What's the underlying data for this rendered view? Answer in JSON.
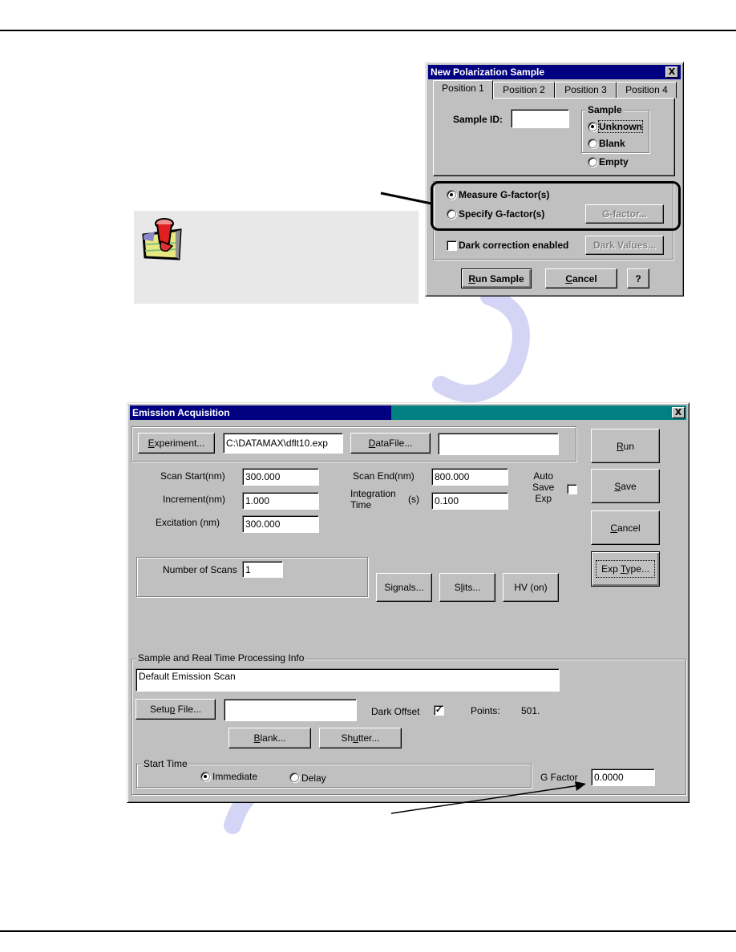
{
  "polarization_dialog": {
    "title": "New Polarization Sample",
    "close_label": "X",
    "tabs": [
      {
        "label": "Position 1",
        "active": true
      },
      {
        "label": "Position 2",
        "active": false
      },
      {
        "label": "Position 3",
        "active": false
      },
      {
        "label": "Position 4",
        "active": false
      }
    ],
    "sample_id_label": "Sample ID:",
    "sample_id_value": "",
    "sample_group_label": "Sample",
    "sample_options": [
      {
        "label": "Unknown",
        "selected": true
      },
      {
        "label": "Blank",
        "selected": false
      },
      {
        "label": "Empty",
        "selected": false
      }
    ],
    "gfactor_options": [
      {
        "label": "Measure G-factor(s)",
        "selected": true
      },
      {
        "label": "Specify G-factor(s)",
        "selected": false
      }
    ],
    "gfactor_button": "G-factor...",
    "dark_correction_label": "Dark correction enabled",
    "dark_correction_checked": false,
    "dark_values_button": "Dark Values...",
    "run_sample_button": {
      "mnemonic": "R",
      "rest": "un Sample"
    },
    "cancel_button": {
      "mnemonic": "C",
      "rest": "ancel"
    },
    "help_button": "?"
  },
  "note_box": {
    "icon": "pushpin-note-icon"
  },
  "emission_dialog": {
    "title": "Emission Acquisition",
    "close_label": "X",
    "colors": {
      "title_active": "#000080",
      "title_inactive": "#008080",
      "face": "#c0c0c0"
    },
    "experiment_button": {
      "mnemonic": "E",
      "rest": "xperiment..."
    },
    "experiment_path": "C:\\DATAMAX\\dflt10.exp",
    "datafile_button": {
      "mnemonic": "D",
      "rest": "ataFile..."
    },
    "datafile_value": "",
    "scan_start_label": "Scan Start(nm)",
    "scan_start_value": "300.000",
    "increment_label": "Increment(nm)",
    "increment_value": "1.000",
    "excitation_label": "Excitation (nm)",
    "excitation_value": "300.000",
    "scan_end_label": "Scan End(nm)",
    "scan_end_value": "800.000",
    "integration_label_1": "Integration",
    "integration_label_2": "Time",
    "integration_unit": "(s)",
    "integration_value": "0.100",
    "auto_save_label_1": "Auto",
    "auto_save_label_2": "Save",
    "auto_save_label_3": "Exp",
    "auto_save_checked": false,
    "run_button": {
      "mnemonic": "R",
      "rest": "un"
    },
    "save_button": {
      "mnemonic": "S",
      "rest": "ave"
    },
    "cancel_button": {
      "mnemonic": "C",
      "rest": "ancel"
    },
    "exp_type_button": {
      "before": "Exp ",
      "mnemonic": "T",
      "rest": "ype..."
    },
    "num_scans_label": "Number of Scans",
    "num_scans_value": "1",
    "signals_button": {
      "before": "Si",
      "mnemonic": "g",
      "rest": "nals..."
    },
    "slits_button": {
      "before": "S",
      "mnemonic": "l",
      "rest": "its..."
    },
    "hv_button": "HV (on)",
    "sample_info_group": "Sample and Real Time Processing Info",
    "sample_info_value": "Default Emission Scan",
    "setup_file_button": {
      "before": "Setu",
      "mnemonic": "p",
      "rest": " File..."
    },
    "setup_file_value": "",
    "dark_offset_label": "Dark Offset",
    "dark_offset_checked": true,
    "points_label": "Points:",
    "points_value": "501.",
    "blank_button": {
      "mnemonic": "B",
      "rest": "lank..."
    },
    "shutter_button": {
      "before": "Sh",
      "mnemonic": "u",
      "rest": "tter..."
    },
    "start_time_group": "Start Time",
    "start_time_options": [
      {
        "label": "Immediate",
        "selected": true
      },
      {
        "label": "Delay",
        "selected": false
      }
    ],
    "g_factor_label": "G Factor",
    "g_factor_value": "0.0000"
  }
}
